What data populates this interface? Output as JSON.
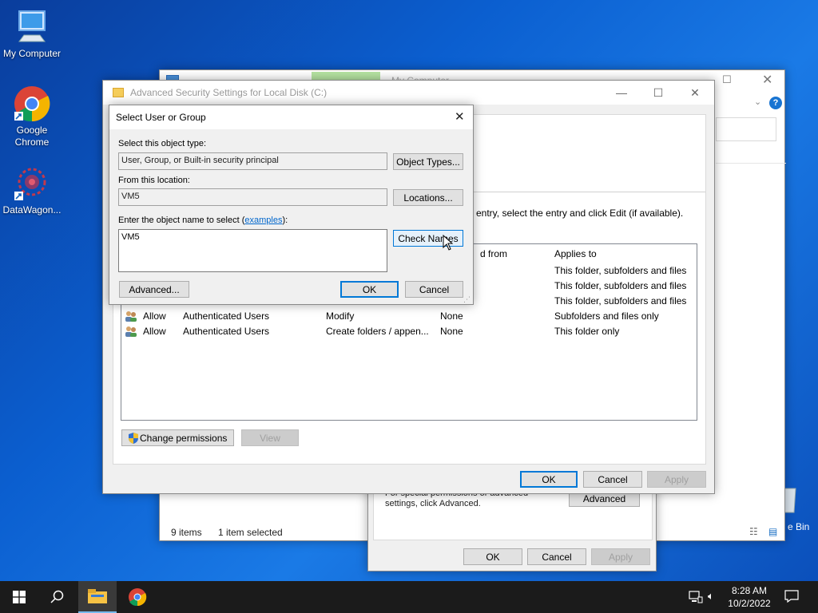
{
  "desktop": {
    "icons": [
      {
        "label": "My Computer"
      },
      {
        "label": "Google Chrome"
      },
      {
        "label": "DataWagon..."
      }
    ],
    "recycle_label": "e Bin"
  },
  "explorer": {
    "title": "My Computer",
    "status_items": "9 items",
    "status_selected": "1 item selected"
  },
  "props_dialog": {
    "special_text": "For special permissions or advanced settings, click Advanced.",
    "advanced_label": "Advanced",
    "ok": "OK",
    "cancel": "Cancel",
    "apply": "Apply"
  },
  "adv_security": {
    "title": "Advanced Security Settings for Local Disk (C:)",
    "info_text": "entry, select the entry and click Edit (if available).",
    "columns": {
      "inherited": "d from",
      "applies": "Applies to"
    },
    "rows": [
      {
        "type": "",
        "principal": "",
        "access": "",
        "inherited": "",
        "applies": "This folder, subfolders and files"
      },
      {
        "type": "",
        "principal": "",
        "access": "",
        "inherited": "",
        "applies": "This folder, subfolders and files"
      },
      {
        "type": "",
        "principal": "",
        "access": "",
        "inherited": "",
        "applies": "This folder, subfolders and files"
      },
      {
        "type": "Allow",
        "principal": "Authenticated Users",
        "access": "Modify",
        "inherited": "None",
        "applies": "Subfolders and files only"
      },
      {
        "type": "Allow",
        "principal": "Authenticated Users",
        "access": "Create folders / appen...",
        "inherited": "None",
        "applies": "This folder only"
      }
    ],
    "change_permissions": "Change permissions",
    "view": "View",
    "ok": "OK",
    "cancel": "Cancel",
    "apply": "Apply"
  },
  "select_user": {
    "title": "Select User or Group",
    "object_type_label": "Select this object type:",
    "object_type_value": "User, Group, or Built-in security principal",
    "object_types_button": "Object Types...",
    "location_label": "From this location:",
    "location_value": "VM5",
    "locations_button": "Locations...",
    "name_label_prefix": "Enter the object name to select (",
    "name_label_link": "examples",
    "name_label_suffix": "):",
    "name_value": "VM5",
    "check_names_button": "Check Names",
    "advanced_button": "Advanced...",
    "ok": "OK",
    "cancel": "Cancel"
  },
  "taskbar": {
    "time": "8:28 AM",
    "date": "10/2/2022"
  }
}
